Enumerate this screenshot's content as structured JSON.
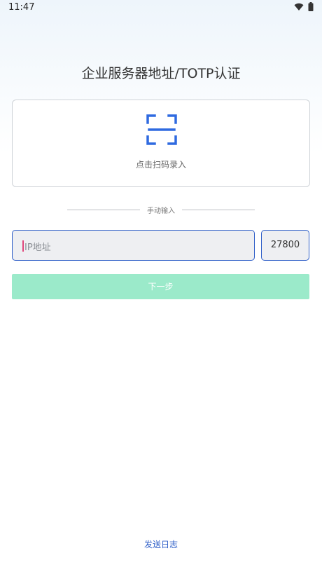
{
  "status_bar": {
    "time": "11:47",
    "icons": [
      "wifi-icon",
      "battery-icon"
    ]
  },
  "page_title": "企业服务器地址/TOTP认证",
  "scan": {
    "label": "点击扫码录入",
    "icon": "qr-scan-icon",
    "accent_color": "#2f6ae0"
  },
  "divider": {
    "label": "手动输入"
  },
  "ip_input": {
    "placeholder": "IP地址",
    "value": ""
  },
  "port_input": {
    "value": "27800"
  },
  "next_button": {
    "label": "下一步",
    "color": "#9beaca"
  },
  "send_log": {
    "label": "发送日志"
  }
}
